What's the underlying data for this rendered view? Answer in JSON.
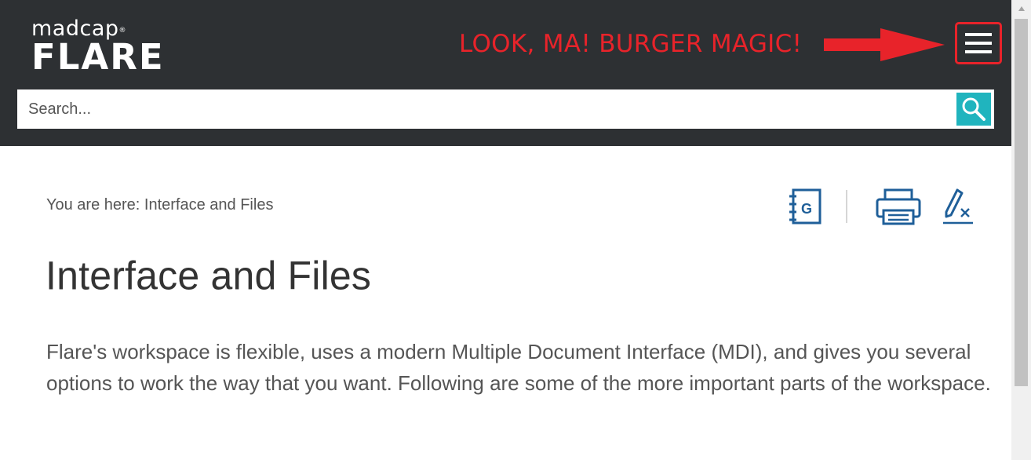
{
  "header": {
    "logo_top": "madcap",
    "logo_registered": "®",
    "logo_bottom": "FLARE",
    "annotation": "LOOK, MA! BURGER MAGIC!",
    "annotation_color": "#e8232a",
    "background_color": "#2d3033"
  },
  "search": {
    "placeholder": "Search...",
    "button_color": "#20b4be"
  },
  "breadcrumb": {
    "text": "You are here: Interface and Files"
  },
  "toolbar": {
    "icons": [
      "glossary-icon",
      "print-icon",
      "remove-highlight-icon"
    ],
    "glossary_letter": "G",
    "icon_color": "#1f5f99"
  },
  "content": {
    "title": "Interface and Files",
    "paragraph": "Flare's workspace is flexible, uses a modern Multiple Document Interface (MDI), and gives you several options to work the way that you want. Following are some of the more important parts of the workspace."
  }
}
